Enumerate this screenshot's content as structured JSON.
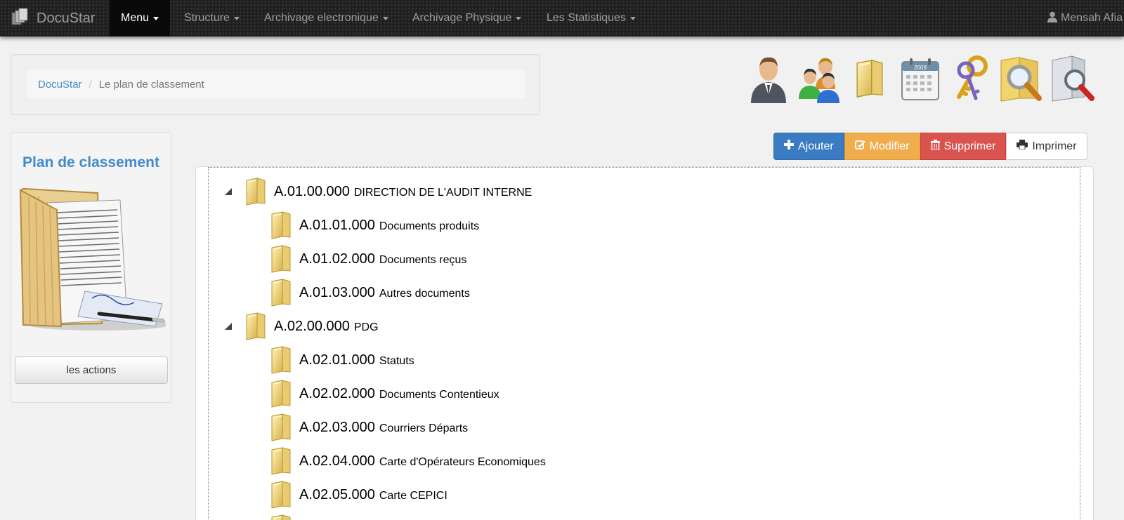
{
  "navbar": {
    "brand": "DocuStar",
    "menus": [
      {
        "label": "Menu",
        "active": true
      },
      {
        "label": "Structure"
      },
      {
        "label": "Archivage electronique"
      },
      {
        "label": "Archivage Physique"
      },
      {
        "label": "Les Statistiques"
      }
    ],
    "user": "Mensah Afia"
  },
  "breadcrumb": {
    "home": "DocuStar",
    "current": "Le plan de classement"
  },
  "top_icons": [
    "user-icon",
    "users-group-icon",
    "folder-icon",
    "calendar-icon",
    "keys-icon",
    "folder-search-icon",
    "document-search-icon"
  ],
  "sidebar": {
    "title": "Plan de classement",
    "actions_button": "les actions"
  },
  "actions": {
    "add": "Ajouter",
    "edit": "Modifier",
    "delete": "Supprimer",
    "print": "Imprimer"
  },
  "colors": {
    "primary": "#3a7bc4",
    "warning": "#f0ad4e",
    "danger": "#d9534f",
    "link": "#428bca"
  },
  "tree": [
    {
      "code": "A.01.00.000",
      "label": "DIRECTION DE L'AUDIT INTERNE",
      "level": 0,
      "expanded": true
    },
    {
      "code": "A.01.01.000",
      "label": "Documents produits",
      "level": 1
    },
    {
      "code": "A.01.02.000",
      "label": "Documents reçus",
      "level": 1
    },
    {
      "code": "A.01.03.000",
      "label": "Autres documents",
      "level": 1
    },
    {
      "code": "A.02.00.000",
      "label": "PDG",
      "level": 0,
      "expanded": true
    },
    {
      "code": "A.02.01.000",
      "label": "Statuts",
      "level": 1
    },
    {
      "code": "A.02.02.000",
      "label": "Documents Contentieux",
      "level": 1
    },
    {
      "code": "A.02.03.000",
      "label": "Courriers Départs",
      "level": 1
    },
    {
      "code": "A.02.04.000",
      "label": "Carte d'Opérateurs Economiques",
      "level": 1
    },
    {
      "code": "A.02.05.000",
      "label": "Carte CEPICI",
      "level": 1
    },
    {
      "code": "",
      "label": "",
      "level": 1
    }
  ]
}
